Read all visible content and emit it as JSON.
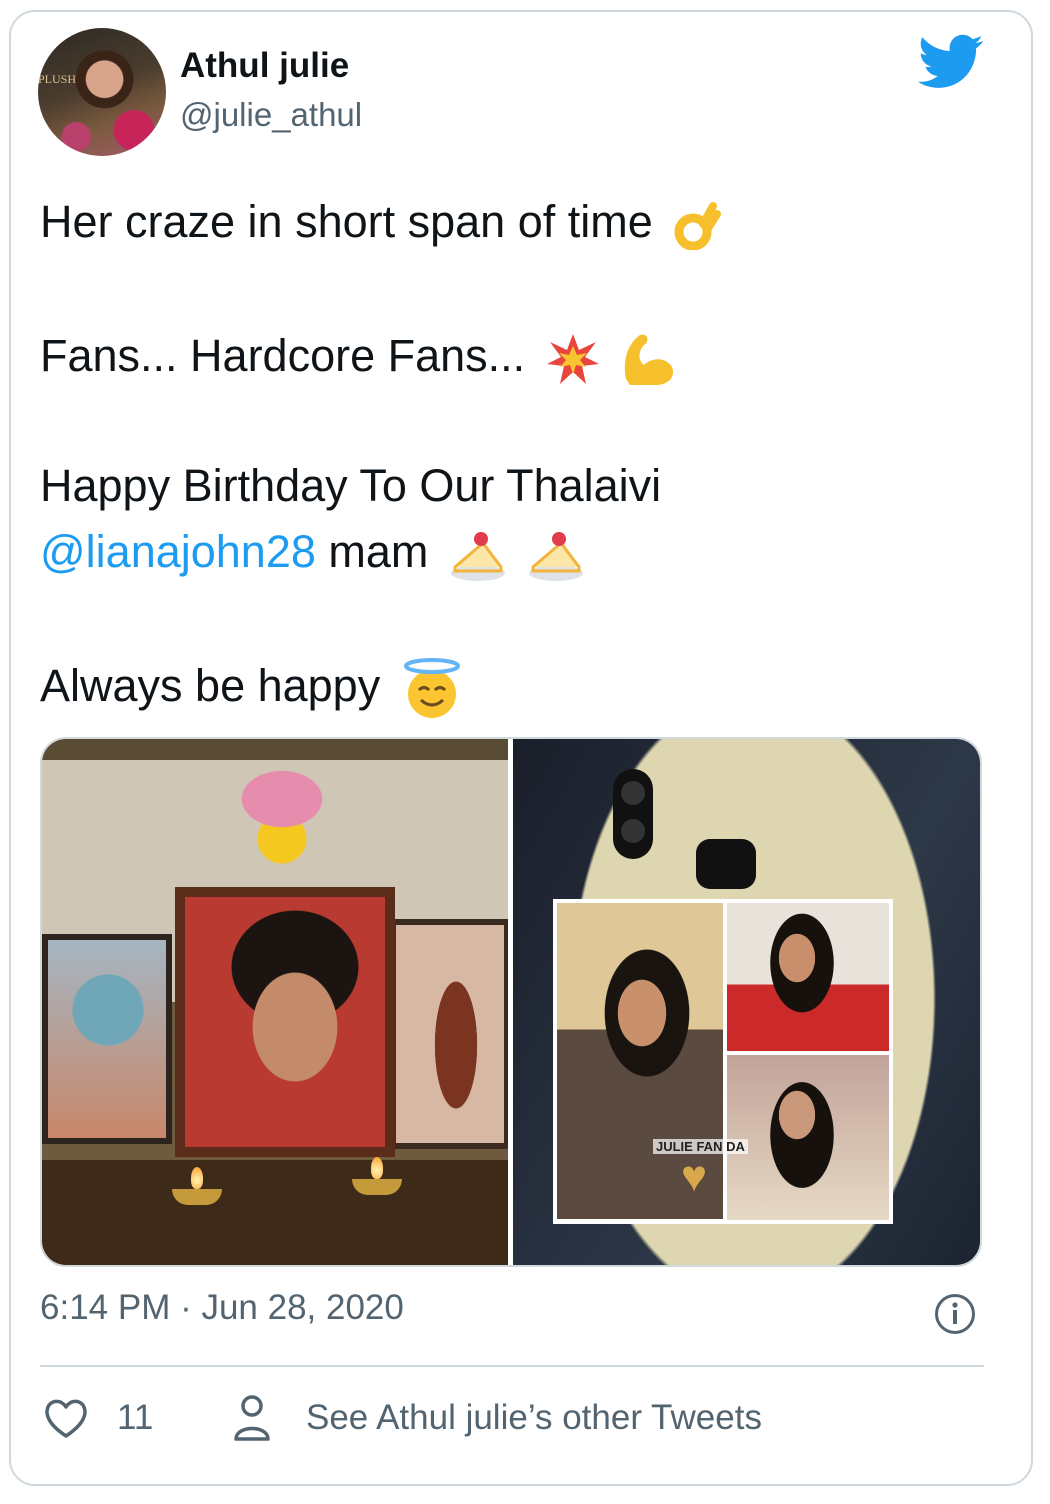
{
  "author": {
    "name": "Athul julie",
    "handle": "@julie_athul",
    "avatar_watermark": "PLUSH"
  },
  "tweet": {
    "line1": "Her craze in short span of time",
    "line1_emoji": "ok-hand",
    "line2": "Fans... Hardcore Fans...",
    "line2_emojis": [
      "collision",
      "flexed-biceps"
    ],
    "line3": "Happy Birthday To Our Thalaivi",
    "mention": "@lianajohn28",
    "line4_suffix": "mam",
    "line4_emojis": [
      "shortcake",
      "shortcake"
    ],
    "line5": "Always be happy",
    "line5_emoji": "smiling-face-with-halo"
  },
  "media": {
    "right_photo_tag": "JULIE FAN DA"
  },
  "timestamp": "6:14 PM · Jun 28, 2020",
  "footer": {
    "like_count": "11",
    "other_tweets_label": "See Athul julie’s other Tweets"
  },
  "colors": {
    "mention": "#1d9bf0",
    "twitter_bird": "#1d9bf0",
    "muted_text": "#536471",
    "border": "#cfd9de"
  },
  "icons": {
    "brand": "twitter-bird-icon",
    "info": "info-icon",
    "like": "heart-icon",
    "profile": "person-icon"
  }
}
